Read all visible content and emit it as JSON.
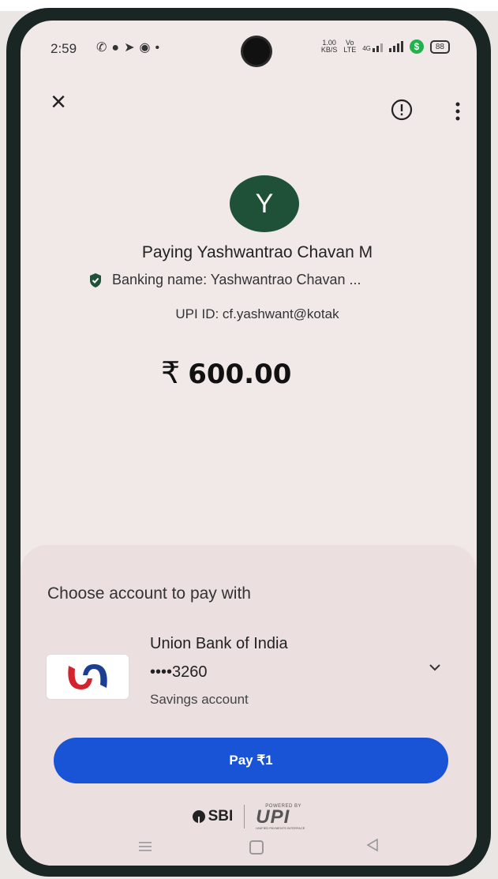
{
  "status_bar": {
    "time": "2:59",
    "left_icons": [
      "whatsapp-icon",
      "chat-icon",
      "telegram-icon",
      "messenger-icon",
      "dot-icon"
    ],
    "network_speed": "1.00\nKB/S",
    "volte": "Vo\nLTE",
    "signal_label": "4G",
    "battery": "88"
  },
  "header": {
    "close_icon": "×",
    "report_icon": "report-icon",
    "more_icon": "more-vert-icon"
  },
  "payee": {
    "avatar_letter": "Y",
    "avatar_color": "#1e5138",
    "paying_text": "Paying Yashwantrao Chavan M",
    "banking_name": "Banking name: Yashwantrao Chavan ...",
    "upi_id": "UPI ID: cf.yashwant@kotak"
  },
  "amount": {
    "currency": "₹",
    "value": "600.00"
  },
  "sheet": {
    "title": "Choose account to pay with",
    "bank_name": "Union Bank of India",
    "account_number": "••••3260",
    "account_type": "Savings account",
    "pay_label": "Pay ₹1",
    "pay_color": "#1953d6",
    "bank_partner": "SBI",
    "powered_by": "POWERED BY",
    "upi_brand": "UPI",
    "upi_subtitle": "UNIFIED PAYMENTS INTERFACE"
  },
  "nav": {
    "icons": [
      "menu-icon",
      "home-icon",
      "back-icon"
    ]
  }
}
